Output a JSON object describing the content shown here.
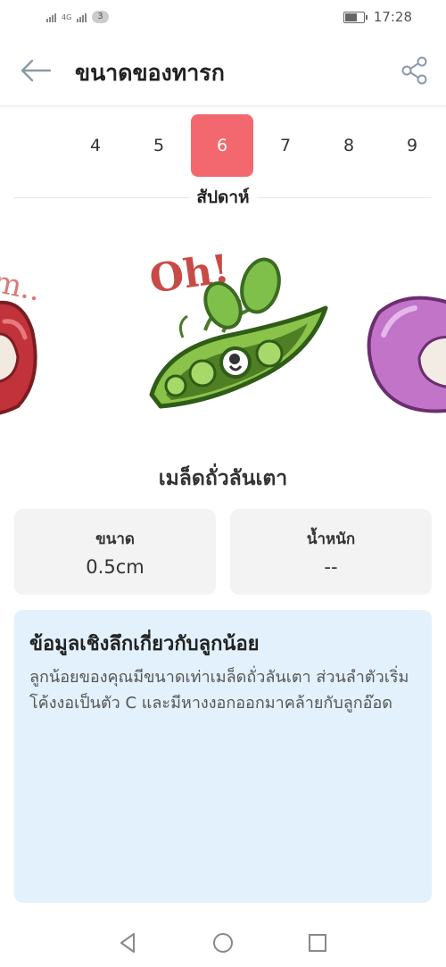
{
  "status_bar": {
    "network_label": "4G",
    "sim_badge": "3",
    "time": "17:28",
    "battery_fill": 0.6
  },
  "app_bar": {
    "title": "ขนาดของทารก",
    "back_icon": "arrow-left-icon",
    "share_icon": "share-icon"
  },
  "week_selector": {
    "weeks": [
      "4",
      "5",
      "6",
      "7",
      "8",
      "9"
    ],
    "selected": "6",
    "label": "สัปดาห์",
    "accent_color": "#f3686f"
  },
  "carousel": {
    "center_caption": "Oh!",
    "left_caption_fragment": "m..",
    "items": [
      "prev-fruit-image",
      "pea-pod-image",
      "next-fruit-image"
    ]
  },
  "fruit_name": "เมล็ดถั่วลันเตา",
  "stats": {
    "size_label": "ขนาด",
    "size_value": "0.5cm",
    "weight_label": "น้ำหนัก",
    "weight_value": "--"
  },
  "insight": {
    "title": "ข้อมูลเชิงลึกเกี่ยวกับลูกน้อย",
    "body": "ลูกน้อยของคุณมีขนาดเท่าเมล็ดถั่วลันเตา ส่วนลำตัวเริ่มโค้งงอเป็นตัว C และมีหางงอกออกมาคล้ายกับลูกอ๊อด",
    "background_color": "#e2f1fc"
  },
  "nav_bar": {
    "icons": [
      "back-triangle-icon",
      "home-circle-icon",
      "recents-square-icon"
    ]
  }
}
